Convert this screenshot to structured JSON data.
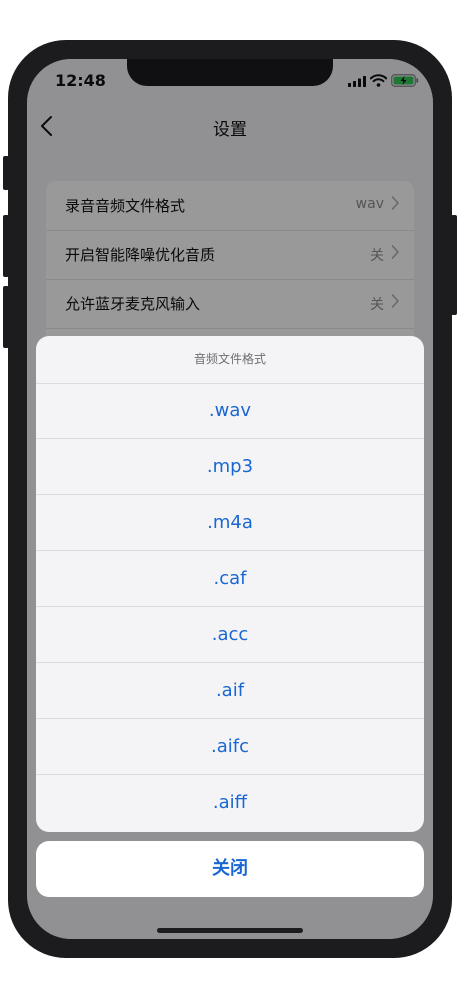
{
  "status_bar": {
    "time": "12:48"
  },
  "nav": {
    "title": "设置"
  },
  "settings": [
    {
      "label": "录音音频文件格式",
      "value": "wav"
    },
    {
      "label": "开启智能降噪优化音质",
      "value": "关"
    },
    {
      "label": "允许蓝牙麦克风输入",
      "value": "关"
    }
  ],
  "action_sheet": {
    "title": "音频文件格式",
    "options": [
      ".wav",
      ".mp3",
      ".m4a",
      ".caf",
      ".acc",
      ".aif",
      ".aifc",
      ".aiff"
    ],
    "close_label": "关闭"
  },
  "colors": {
    "accent": "#1967d2",
    "battery": "#34c759"
  }
}
